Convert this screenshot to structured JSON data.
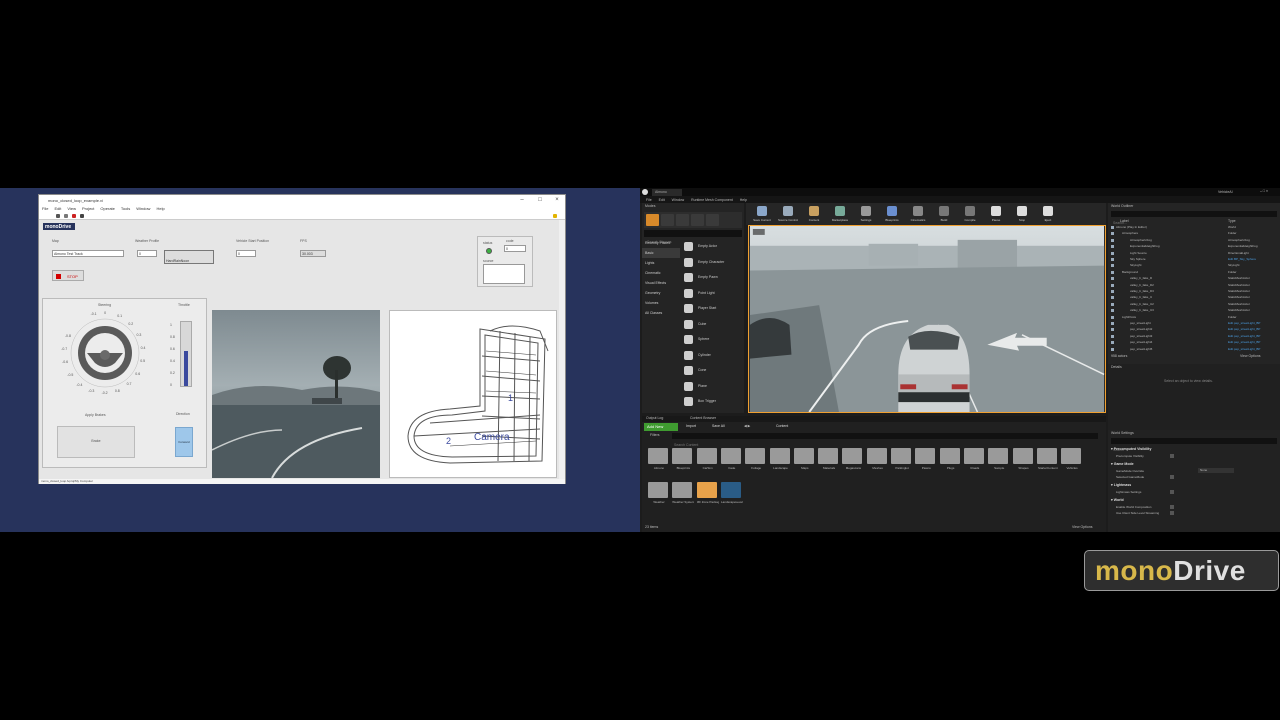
{
  "colors": {
    "desktop_bg": "#27335c",
    "ue_bg": "#1c1c1c",
    "brand_gold": "#d8b84a",
    "viewport_border": "#f0a030"
  },
  "labview": {
    "title": "mono_closed_loop_example.vi",
    "menus": [
      "File",
      "Edit",
      "View",
      "Project",
      "Operate",
      "Tools",
      "Window",
      "Help"
    ],
    "logo": "monoDrive",
    "map_label": "Map",
    "map_value": "Almono Test Track",
    "weather_label": "Weather Profile",
    "weather_value": "0",
    "weather_name": "HardRainNoon",
    "vehicle_pos_label": "Vehicle Start Position",
    "vehicle_pos_value": "0",
    "fps_label": "FPS",
    "fps_value": "30.003",
    "status_label": "status",
    "code_label": "code",
    "code_value": "0",
    "source_label": "source",
    "stop_label": "STOP",
    "steering_label": "Steering",
    "throttle_label": "Throttle",
    "apply_brakes_label": "Apply Brakes",
    "brake_button": "Brake",
    "direction_label": "Direction",
    "direction_value": "Forward",
    "statusbar": "mono_closed_loop.lvproj/My Computer",
    "dial_ticks": [
      "-0.1",
      "0",
      "0.1",
      "0.2",
      "0.3",
      "0.4",
      "0.5",
      "0.6",
      "0.7",
      "0.8",
      "-0.2",
      "-0.3",
      "-0.4",
      "-0.5",
      "-0.6",
      "-0.7",
      "-0.8"
    ],
    "throttle_ticks": [
      "1",
      "0.8",
      "0.6",
      "0.4",
      "0.2",
      "0"
    ],
    "throttle_level": 0.55,
    "map_markers": {
      "one": "1",
      "two": "2",
      "camera": "Camera"
    }
  },
  "unreal": {
    "tab": "Almono",
    "menus": [
      "File",
      "Edit",
      "Window",
      "Runtime Mesh Component",
      "Help"
    ],
    "user": "VehicleAI",
    "modes_title": "Modes",
    "search_classes_placeholder": "Search Classes",
    "categories": [
      "Recently Placed",
      "Basic",
      "Lights",
      "Cinematic",
      "Visual Effects",
      "Geometry",
      "Volumes",
      "All Classes"
    ],
    "place_items": [
      "Empty Actor",
      "Empty Character",
      "Empty Pawn",
      "Point Light",
      "Player Start",
      "Cube",
      "Sphere",
      "Cylinder",
      "Cone",
      "Plane",
      "Box Trigger"
    ],
    "toolbar": [
      "Save Current",
      "Source Control",
      "Content",
      "Marketplace",
      "Settings",
      "Blueprints",
      "Cinematics",
      "Build",
      "Compile",
      "Pause",
      "Stop",
      "Eject"
    ],
    "world_outliner": {
      "title": "World Outliner",
      "search_placeholder": "Search...",
      "col_label": "Label",
      "col_type": "Type",
      "rows": [
        {
          "label": "Almono (Play In Editor)",
          "type": "World"
        },
        {
          "label": "Atmosphere",
          "type": "Folder"
        },
        {
          "label": "AtmosphericFog",
          "type": "AtmosphericFog"
        },
        {
          "label": "ExponentialHeightFog",
          "type": "ExponentialHeightFog"
        },
        {
          "label": "Light Source",
          "type": "DirectionalLight"
        },
        {
          "label": "Sky Sphere",
          "type": "Edit BP_Sky_Sphere"
        },
        {
          "label": "SkyLight",
          "type": "SkyLight"
        },
        {
          "label": "Background",
          "type": "Folder"
        },
        {
          "label": "valley_b_fake_D",
          "type": "StaticMeshActor"
        },
        {
          "label": "valley_b_fake_D2",
          "type": "StaticMeshActor"
        },
        {
          "label": "valley_b_fake_D3",
          "type": "StaticMeshActor"
        },
        {
          "label": "valley_b_fake_U",
          "type": "StaticMeshActor"
        },
        {
          "label": "valley_b_fake_U2",
          "type": "StaticMeshActor"
        },
        {
          "label": "valley_b_fake_U3",
          "type": "StaticMeshActor"
        },
        {
          "label": "LightPosts",
          "type": "Folder"
        },
        {
          "label": "pep_streetLight",
          "type": "Edit pep_streetLight_BP"
        },
        {
          "label": "pep_streetLight2",
          "type": "Edit pep_streetLight_BP"
        },
        {
          "label": "pep_streetLight3",
          "type": "Edit pep_streetLight_BP"
        },
        {
          "label": "pep_streetLight4",
          "type": "Edit pep_streetLight_BP"
        },
        {
          "label": "pep_streetLight5",
          "type": "Edit pep_streetLight_BP"
        }
      ],
      "actors_count": "958 actors",
      "view_options": "View Options"
    },
    "details": {
      "title": "Details",
      "hint": "Select an object to view details."
    },
    "world_settings": {
      "title": "World Settings",
      "search_placeholder": "Search",
      "sections": [
        {
          "name": "Precomputed Visibility",
          "rows": [
            "Precompute Visibility"
          ]
        },
        {
          "name": "Game Mode",
          "rows": [
            "GameMode Override",
            "Selected GameMode"
          ]
        },
        {
          "name": "Lightmass",
          "rows": [
            "Lightmass Settings"
          ]
        },
        {
          "name": "World",
          "rows": [
            "Enable World Composition",
            "Use Client Side Level Streaming"
          ]
        }
      ],
      "gamemode_value": "None"
    },
    "content_browser": {
      "tabs": [
        "Output Log",
        "Content Browser"
      ],
      "add_new": "Add New",
      "import": "Import",
      "save_all": "Save All",
      "path": "Content",
      "filters": "Filters",
      "search_placeholder": "Search Content",
      "assets_row1": [
        "Almono",
        "Blueprints",
        "CarSim",
        "Fade",
        "Foliage",
        "Landscape",
        "Maps",
        "Materials",
        "Megascans",
        "Meshes",
        "Parkinglot",
        "Pawns",
        "Plugs",
        "Roads",
        "Sample",
        "Shapes",
        "StarterContent",
        "Vehicles"
      ],
      "assets_row2": [
        "Weather",
        "Weather System",
        "MF Zone Package",
        "LandscapeLevel"
      ],
      "item_count": "23 items",
      "view_options": "View Options"
    }
  },
  "brand": {
    "mono": "mono",
    "drive": "Drive"
  }
}
